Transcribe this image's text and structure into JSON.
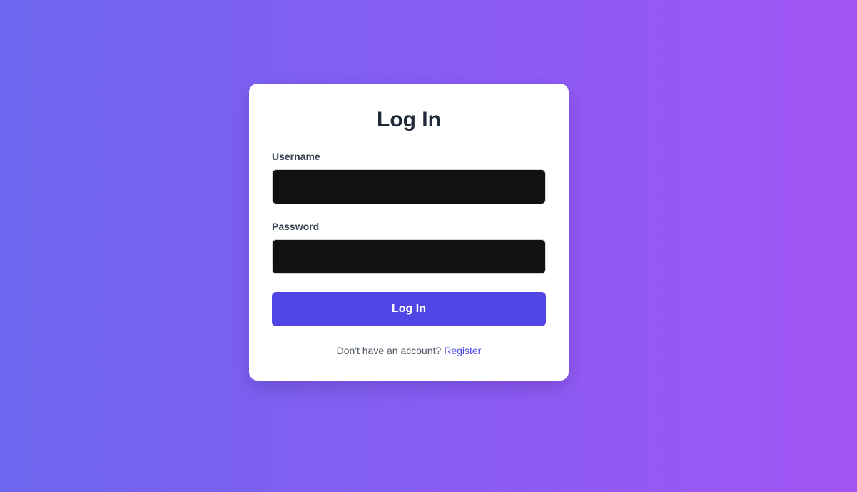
{
  "login_form": {
    "title": "Log In",
    "username": {
      "label": "Username",
      "value": "",
      "placeholder": ""
    },
    "password": {
      "label": "Password",
      "value": "",
      "placeholder": ""
    },
    "submit_label": "Log In",
    "footer_text": "Don't have an account?",
    "register_link": "Register"
  },
  "colors": {
    "background_gradient_start": "#6d66ee",
    "background_gradient_end": "#a155f3",
    "card_background": "#ffffff",
    "input_background": "#111111",
    "accent": "#4f46e5",
    "title_text": "#1f2937"
  }
}
